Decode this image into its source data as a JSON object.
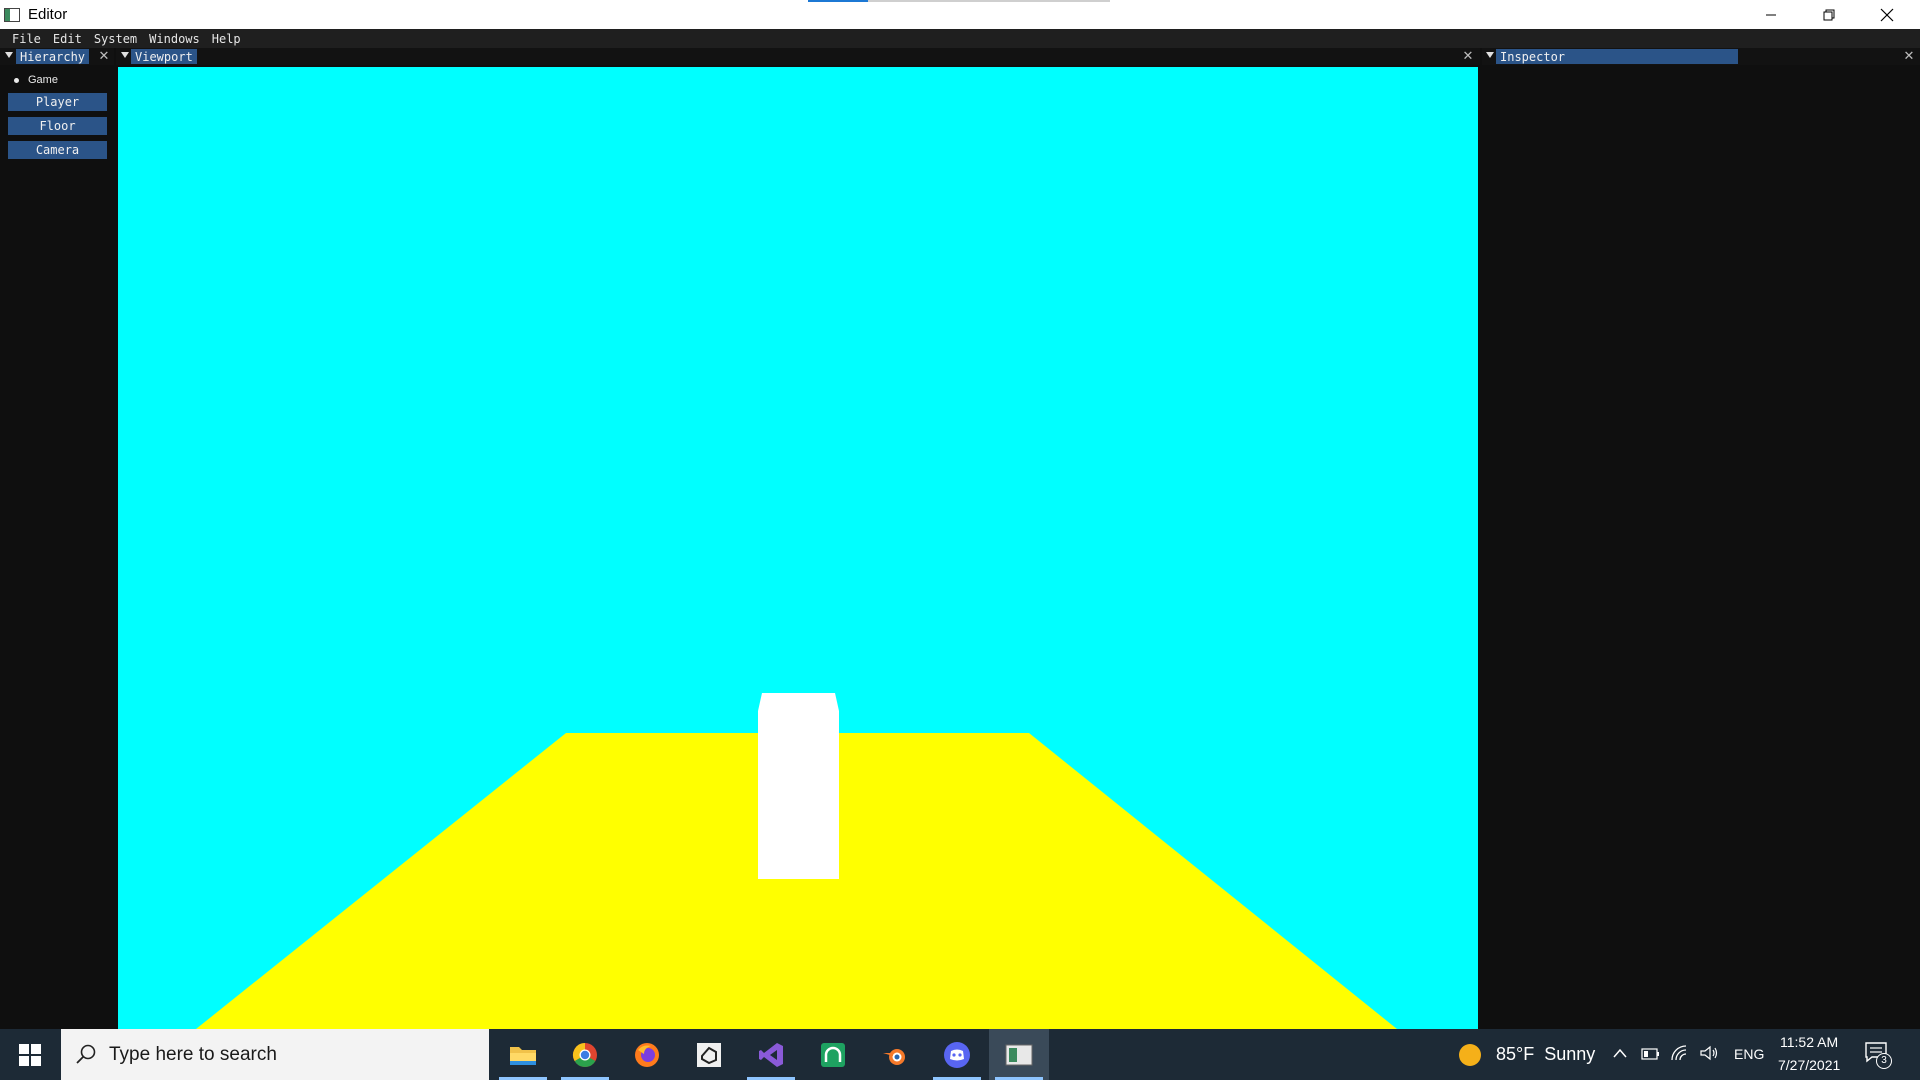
{
  "window": {
    "title": "Editor",
    "progress": 0.2
  },
  "menu": [
    "File",
    "Edit",
    "System",
    "Windows",
    "Help"
  ],
  "hierarchy": {
    "tab_label": "Hierarchy",
    "root": "Game",
    "items": [
      "Player",
      "Floor",
      "Camera"
    ]
  },
  "viewport": {
    "tab_label": "Viewport",
    "sky_color": "#00ffff",
    "floor_color": "#ffff00",
    "player_color": "#ffffff"
  },
  "inspector": {
    "tab_label": "Inspector"
  },
  "taskbar": {
    "search_placeholder": "Type here to search",
    "apps": [
      "file-explorer",
      "chrome",
      "firefox",
      "unity-hub",
      "visual-studio",
      "gitkraken",
      "blender",
      "discord",
      "editor"
    ],
    "weather": "85°F  Sunny",
    "language": "ENG",
    "time": "11:52 AM",
    "date": "7/27/2021",
    "notification_count": "3"
  }
}
